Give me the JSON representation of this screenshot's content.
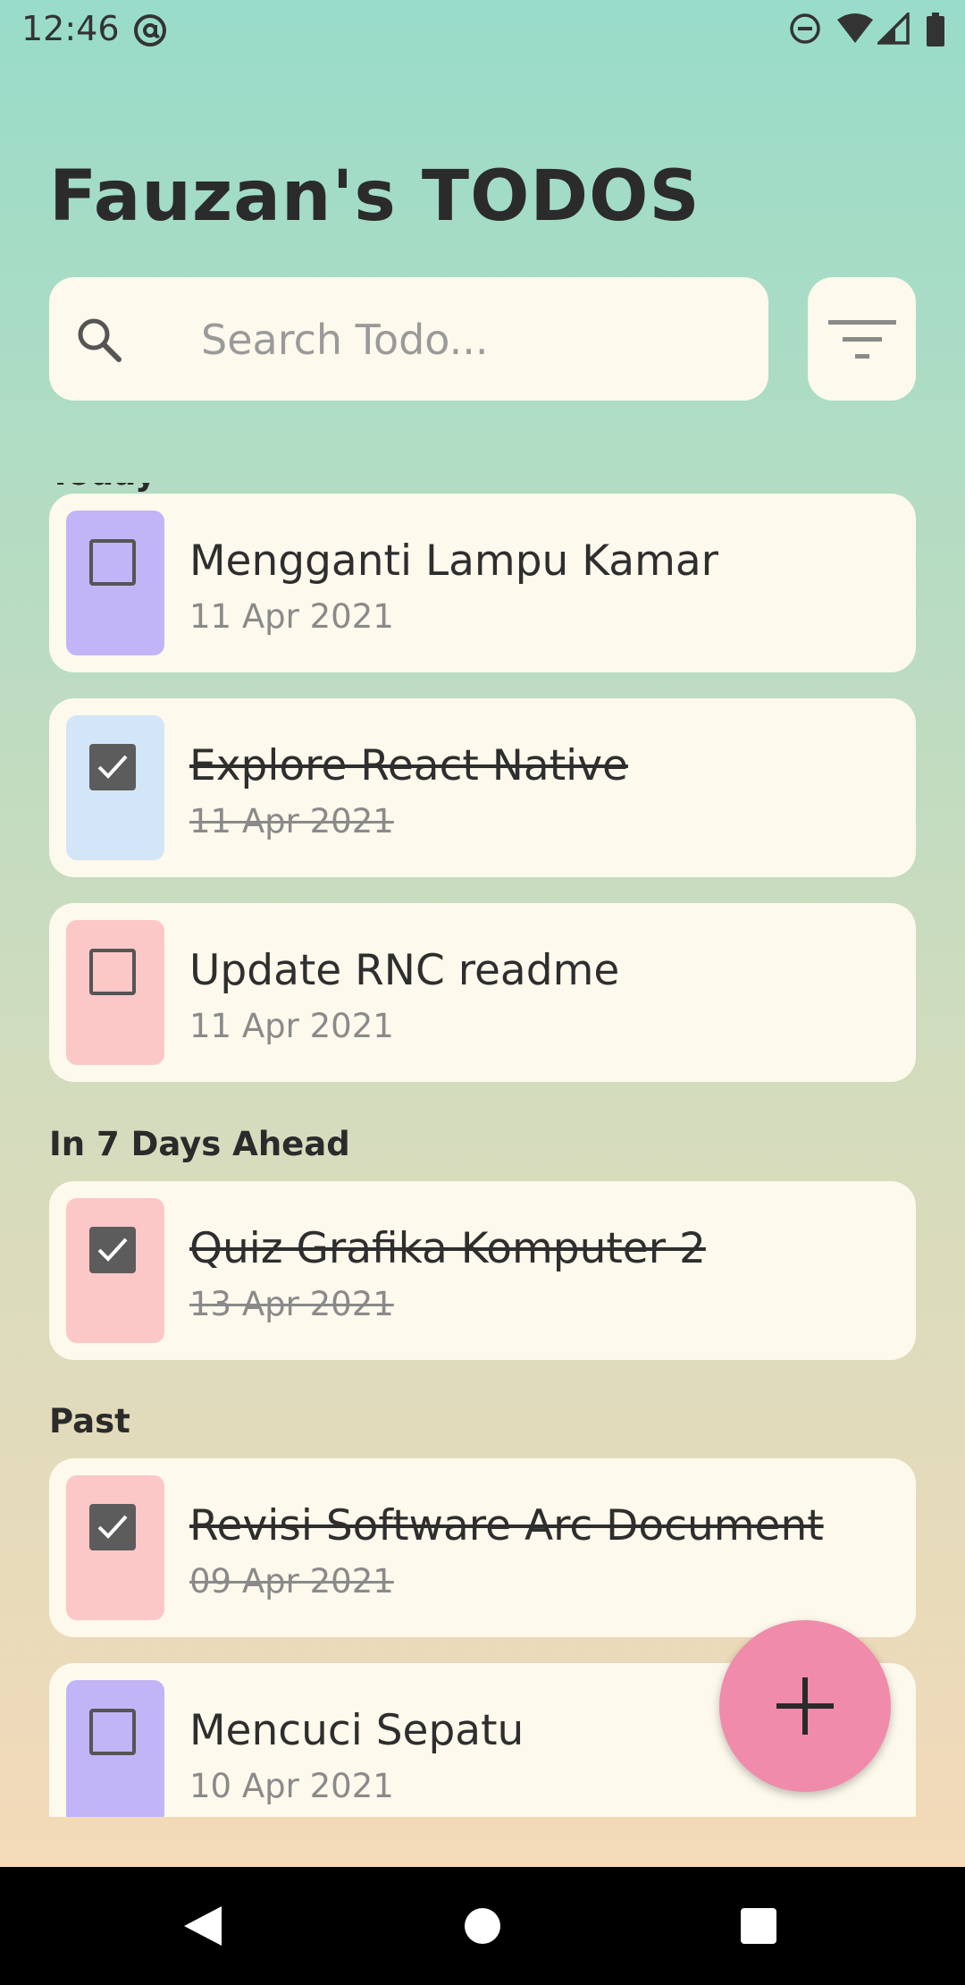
{
  "status_bar": {
    "time": "12:46",
    "icons": [
      "at-sign-icon",
      "do-not-disturb-icon",
      "wifi-icon",
      "signal-icon",
      "battery-icon"
    ]
  },
  "title": "Fauzan's TODOS",
  "search": {
    "placeholder": "Search Todo...",
    "value": ""
  },
  "sections": [
    {
      "title": "Today",
      "todos": [
        {
          "title": "Mengganti Lampu Kamar",
          "date": "11 Apr 2021",
          "done": false,
          "color": "#c2b5f7"
        },
        {
          "title": "Explore React Native",
          "date": "11 Apr 2021",
          "done": true,
          "color": "#d3e6f8"
        },
        {
          "title": "Update RNC readme",
          "date": "11 Apr 2021",
          "done": false,
          "color": "#fcc7c7"
        }
      ]
    },
    {
      "title": "In 7 Days Ahead",
      "todos": [
        {
          "title": "Quiz Grafika Komputer 2",
          "date": "13 Apr 2021",
          "done": true,
          "color": "#fcc7c7"
        }
      ]
    },
    {
      "title": "Past",
      "todos": [
        {
          "title": "Revisi Software Arc Document",
          "date": "09 Apr 2021",
          "done": true,
          "color": "#fcc7c7"
        },
        {
          "title": "Mencuci Sepatu",
          "date": "10 Apr 2021",
          "done": false,
          "color": "#c2b5f7"
        }
      ]
    }
  ],
  "colors": {
    "accent": "#f08bab",
    "card_background": "#fdf9ec",
    "checkbox_checked": "#5c5c5c"
  }
}
